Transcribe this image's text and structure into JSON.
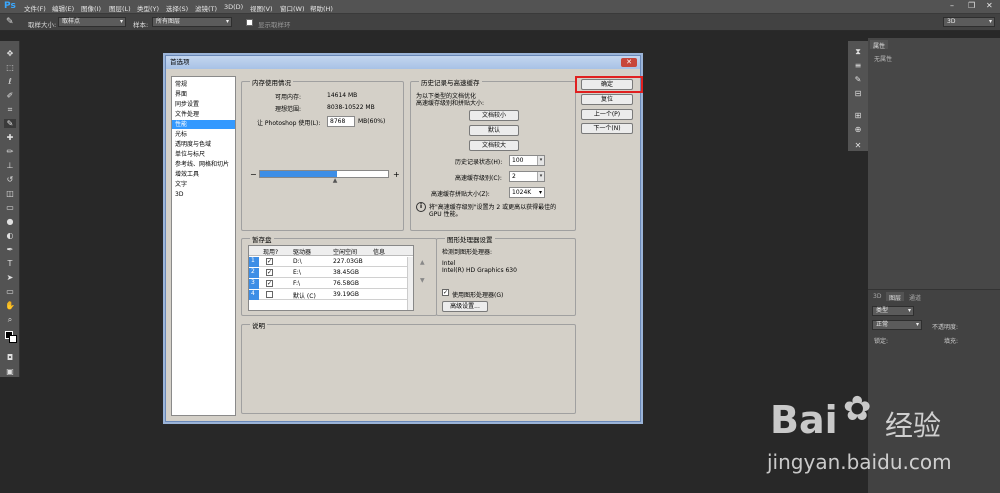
{
  "menubar": {
    "logo": "Ps",
    "items": [
      "文件(F)",
      "编辑(E)",
      "图像(I)",
      "图层(L)",
      "类型(Y)",
      "选择(S)",
      "滤镜(T)",
      "3D(D)",
      "视图(V)",
      "窗口(W)",
      "帮助(H)"
    ]
  },
  "optbar": {
    "sample_size_label": "取样大小:",
    "sample_size_value": "取样点",
    "sample_label": "样本:",
    "sample_value": "所有图层",
    "show_ring_label": "显示取样环",
    "workspace_value": "3D"
  },
  "rightpanel": {
    "props_tab": "属性",
    "props_empty": "无属性",
    "layers_tabs": [
      "3D",
      "图层",
      "通道"
    ],
    "kind_label": "类型",
    "blend_mode": "正常",
    "opacity_label": "不透明度:",
    "lock_label": "锁定:",
    "fill_label": "填充:"
  },
  "dialog": {
    "title": "首选项",
    "close": "✕",
    "categories": [
      "常规",
      "界面",
      "同步设置",
      "文件处理",
      "性能",
      "光标",
      "透明度与色域",
      "单位与标尺",
      "参考线、网格和切片",
      "增效工具",
      "文字",
      "3D"
    ],
    "selected_category": "性能",
    "memory": {
      "title": "内存使用情况",
      "available_label": "可用内存:",
      "available_value": "14614 MB",
      "ideal_label": "理想范围:",
      "ideal_value": "8038-10522 MB",
      "use_label": "让 Photoshop 使用(L):",
      "use_value": "8768",
      "use_unit": "MB(60%)",
      "minus": "−",
      "plus": "+",
      "slider_fraction": 0.6
    },
    "history": {
      "title": "历史记录与高速缓存",
      "hint_line1": "为以下类型的文档优化",
      "hint_line2": "高速缓存级别和拼贴大小:",
      "btn_small": "文档较小",
      "btn_default": "默认",
      "btn_large": "文档较大",
      "history_states_label": "历史记录状态(H):",
      "history_states_value": "100",
      "cache_levels_label": "高速缓存级别(C):",
      "cache_levels_value": "2",
      "tile_size_label": "高速缓存拼贴大小(Z):",
      "tile_size_value": "1024K",
      "info_line1": "将\"高速缓存级别\"设置为 2 或更高以获得最佳的",
      "info_line2": "GPU 性能。"
    },
    "scratch": {
      "title": "暂存盘",
      "headers": [
        "现用?",
        "驱动器",
        "空闲空间",
        "信息"
      ],
      "rows": [
        {
          "n": "1",
          "checked": "✓",
          "drive": "D:\\",
          "free": "227.03GB"
        },
        {
          "n": "2",
          "checked": "✓",
          "drive": "E:\\",
          "free": "38.45GB"
        },
        {
          "n": "3",
          "checked": "✓",
          "drive": "F:\\",
          "free": "76.58GB"
        },
        {
          "n": "4",
          "checked": "",
          "drive": "默认 (C)",
          "free": "39.19GB"
        }
      ]
    },
    "gpu": {
      "title": "图形处理器设置",
      "detected_label": "检测到图形处理器:",
      "vendor": "Intel",
      "model": "Intel(R) HD Graphics 630",
      "use_gpu_label": "使用图形处理器(G)",
      "use_gpu_checked": "✓",
      "advanced_btn": "高级设置..."
    },
    "description": {
      "title": "说明"
    },
    "buttons": {
      "ok": "确定",
      "reset": "复位",
      "prev": "上一个(P)",
      "next": "下一个(N)"
    }
  },
  "watermark": {
    "brand": "Bai",
    "brand_suffix": "经验",
    "url": "jingyan.baidu.com"
  },
  "colors": {
    "highlight": "#e02020",
    "selection": "#3399ff",
    "slider": "#3d8ee6"
  }
}
